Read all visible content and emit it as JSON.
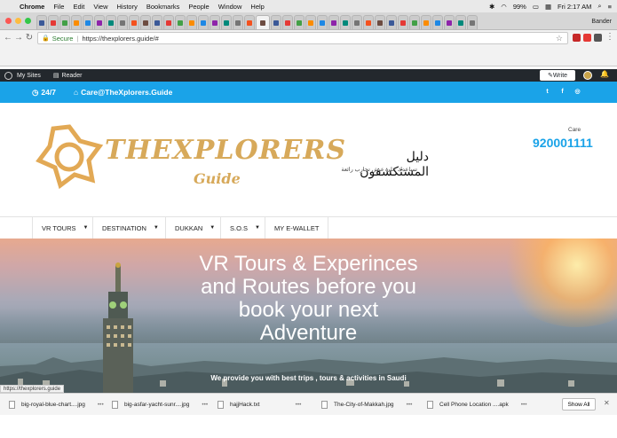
{
  "menubar": {
    "app": "Chrome",
    "items": [
      "File",
      "Edit",
      "View",
      "History",
      "Bookmarks",
      "People",
      "Window",
      "Help"
    ],
    "battery": "99%",
    "clock": "Fri 2:17 AM"
  },
  "browser": {
    "profile": "Bander",
    "address": {
      "secure_label": "Secure",
      "url": "https://thexplorers.guide/#"
    }
  },
  "wp_admin_bar": {
    "my_sites": "My Sites",
    "reader": "Reader",
    "write": "Write"
  },
  "top_strip": {
    "hours": "24/7",
    "email": "Care@TheXplorers.Guide",
    "social_icons": [
      "twitter-icon",
      "facebook-icon",
      "instagram-icon"
    ]
  },
  "header": {
    "logo_text": "THEXPLORERS",
    "logo_subtext": "Guide",
    "arabic_title": "دليل المستكشفون",
    "arabic_subtitle": "تساعدك على عيش تجارب رائعة",
    "care_label": "Care",
    "care_number": "920001111"
  },
  "nav": {
    "items": [
      {
        "label": "VR TOURS",
        "has_menu": true
      },
      {
        "label": "DESTINATION",
        "has_menu": true
      },
      {
        "label": "DUKKAN",
        "has_menu": true
      },
      {
        "label": "S.O.S",
        "has_menu": true
      },
      {
        "label": "MY E-WALLET",
        "has_menu": false
      }
    ]
  },
  "hero": {
    "line1": "VR Tours & Experinces",
    "line2": "and Routes before you",
    "line3": "book your next",
    "line4": "Adventure",
    "subtitle": "We provide you with best trips , tours & activities in Saudi"
  },
  "status_bar": {
    "url": "https://thexplorers.guide"
  },
  "downloads": {
    "files": [
      "big-royal-blue-chart....jpg",
      "big-asfar-yacht-sunr....jpg",
      "hajjHack.txt",
      "The-City-of-Makkah.jpg",
      "Cell Phone Location ....apk"
    ],
    "show_all": "Show All"
  },
  "colors": {
    "accent_blue": "#1aa3e8",
    "logo_gold": "#d7a95a",
    "wp_bar": "#23282d"
  }
}
